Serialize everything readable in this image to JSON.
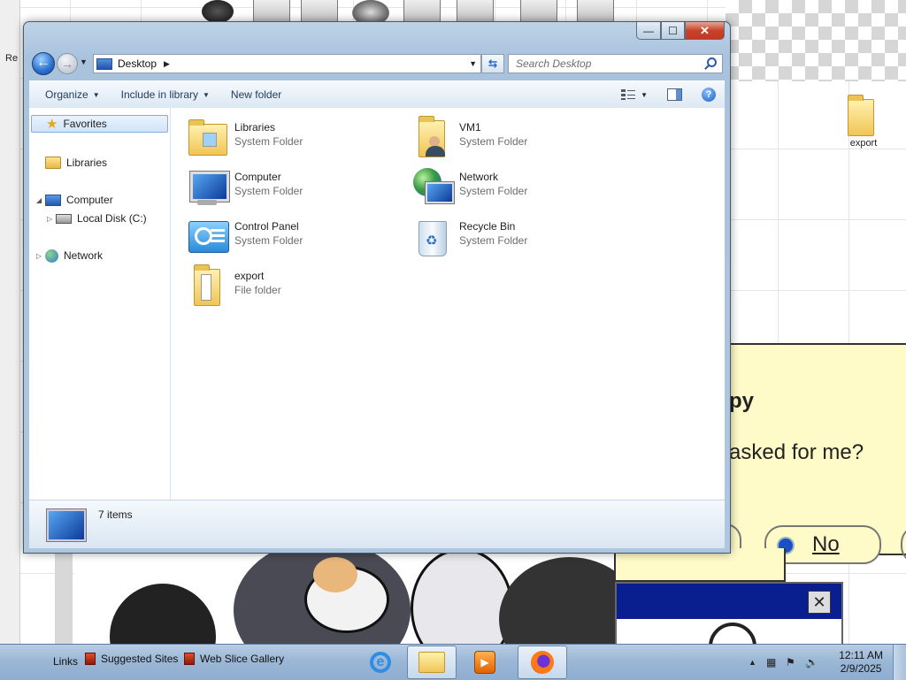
{
  "desktop": {
    "partial_label": "Re",
    "export_icon_label": "export",
    "dialog_heading": "py",
    "dialog_question": "asked for me?",
    "dialog_option": "No",
    "mini_close": "✕"
  },
  "window": {
    "controls": {
      "minimize": "—",
      "maximize": "☐",
      "close": "✕"
    },
    "address": {
      "location": "Desktop",
      "separator": "▶",
      "dropdown": "▼"
    },
    "refresh": "⇆",
    "search_placeholder": "Search Desktop",
    "toolbar": {
      "organize": "Organize",
      "include_in_library": "Include in library",
      "new_folder": "New folder",
      "caret": "▼"
    },
    "help": "?",
    "nav_pane": {
      "favorites": "Favorites",
      "libraries": "Libraries",
      "computer": "Computer",
      "local_disk": "Local Disk (C:)",
      "network": "Network"
    },
    "items": [
      {
        "name": "Libraries",
        "type": "System Folder",
        "icon": "libraries-icon"
      },
      {
        "name": "VM1",
        "type": "System Folder",
        "icon": "user-folder-icon"
      },
      {
        "name": "Computer",
        "type": "System Folder",
        "icon": "computer-icon"
      },
      {
        "name": "Network",
        "type": "System Folder",
        "icon": "network-icon"
      },
      {
        "name": "Control Panel",
        "type": "System Folder",
        "icon": "control-panel-icon"
      },
      {
        "name": "Recycle Bin",
        "type": "System Folder",
        "icon": "recycle-bin-icon"
      },
      {
        "name": "export",
        "type": "File folder",
        "icon": "folder-icon"
      }
    ],
    "details": {
      "count": "7 items"
    }
  },
  "taskbar": {
    "links_label": "Links",
    "links": [
      "Suggested Sites",
      "Web Slice Gallery"
    ],
    "clock": {
      "time": "12:11 AM",
      "date": "2/9/2025"
    },
    "tray_expand": "▲"
  },
  "colors": {
    "accent": "#1e395b",
    "taskbar": "#9bb7d6",
    "close_button": "#c7432a"
  }
}
